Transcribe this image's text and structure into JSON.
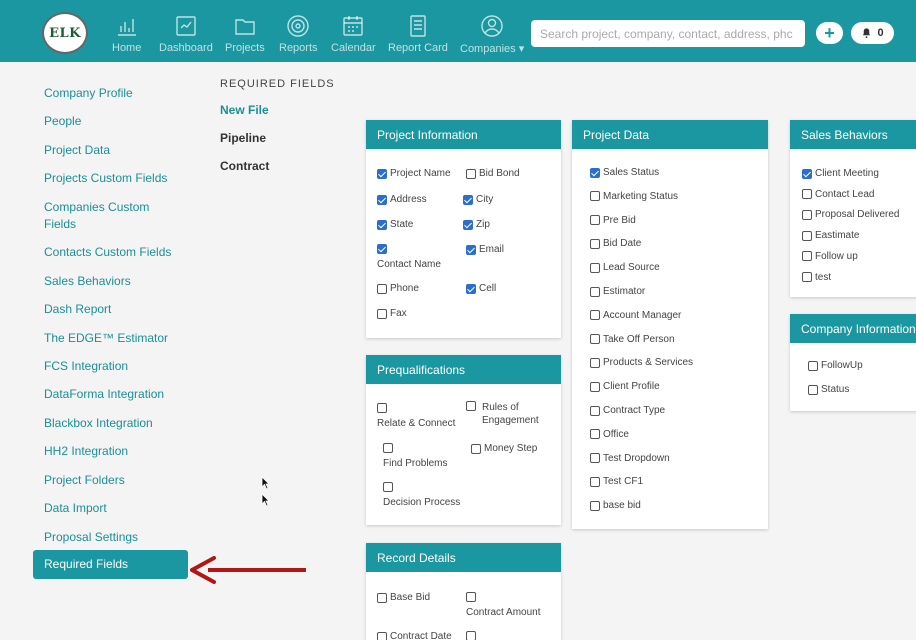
{
  "header": {
    "logo_text": "ELK",
    "nav": [
      {
        "label": "Home",
        "icon": "bar-chart-icon"
      },
      {
        "label": "Dashboard",
        "icon": "dashboard-icon"
      },
      {
        "label": "Projects",
        "icon": "folder-icon"
      },
      {
        "label": "Reports",
        "icon": "target-icon"
      },
      {
        "label": "Calendar",
        "icon": "calendar-icon"
      },
      {
        "label": "Report Card",
        "icon": "report-card-icon"
      },
      {
        "label": "Companies ▾",
        "icon": "user-icon"
      }
    ],
    "search_placeholder": "Search project, company, contact, address, phc",
    "add_label": "+",
    "notification_count": "0"
  },
  "sidebar": {
    "items": [
      "Company Profile",
      "People",
      "Project Data",
      "Projects Custom Fields",
      "Companies Custom Fields",
      "Contacts Custom Fields",
      "Sales Behaviors",
      "Dash Report",
      "The EDGE™ Estimator",
      "FCS Integration",
      "DataForma Integration",
      "Blackbox Integration",
      "HH2 Integration",
      "Project Folders",
      "Data Import",
      "Proposal Settings"
    ],
    "active": "Required Fields"
  },
  "required_fields": {
    "heading": "REQUIRED FIELDS",
    "items": [
      "New File",
      "Pipeline",
      "Contract"
    ]
  },
  "cards": {
    "project_information": {
      "title": "Project Information",
      "options": [
        {
          "label": "Project Name",
          "checked": true
        },
        {
          "label": "Bid Bond",
          "checked": false
        },
        {
          "label": "Address",
          "checked": true
        },
        {
          "label": "City",
          "checked": true
        },
        {
          "label": "State",
          "checked": true
        },
        {
          "label": "Zip",
          "checked": true
        },
        {
          "label": "Contact Name",
          "checked": true
        },
        {
          "label": "Email",
          "checked": true
        },
        {
          "label": "Phone",
          "checked": false
        },
        {
          "label": "Cell",
          "checked": true
        },
        {
          "label": "Fax",
          "checked": false
        }
      ]
    },
    "prequalifications": {
      "title": "Prequalifications",
      "options": [
        {
          "label": "Relate & Connect",
          "checked": false
        },
        {
          "label": "Rules of Engagement",
          "checked": false
        },
        {
          "label": "Find Problems",
          "checked": false
        },
        {
          "label": "Money Step",
          "checked": false
        },
        {
          "label": "Decision Process",
          "checked": false
        }
      ]
    },
    "record_details": {
      "title": "Record Details",
      "options": [
        {
          "label": "Base Bid",
          "checked": false
        },
        {
          "label": "Contract Amount",
          "checked": false
        },
        {
          "label": "Contract Date",
          "checked": false
        }
      ]
    },
    "project_data": {
      "title": "Project Data",
      "options": [
        {
          "label": "Sales Status",
          "checked": true
        },
        {
          "label": "Marketing Status",
          "checked": false
        },
        {
          "label": "Pre Bid",
          "checked": false
        },
        {
          "label": "Bid Date",
          "checked": false
        },
        {
          "label": "Lead Source",
          "checked": false
        },
        {
          "label": "Estimator",
          "checked": false
        },
        {
          "label": "Account Manager",
          "checked": false
        },
        {
          "label": "Take Off Person",
          "checked": false
        },
        {
          "label": "Products & Services",
          "checked": false
        },
        {
          "label": "Client Profile",
          "checked": false
        },
        {
          "label": "Contract Type",
          "checked": false
        },
        {
          "label": "Office",
          "checked": false
        },
        {
          "label": "Test Dropdown",
          "checked": false
        },
        {
          "label": "Test CF1",
          "checked": false
        },
        {
          "label": "base bid",
          "checked": false
        }
      ]
    },
    "sales_behaviors": {
      "title": "Sales Behaviors",
      "options": [
        {
          "label": "Client Meeting",
          "checked": true
        },
        {
          "label": "Contact Lead",
          "checked": false
        },
        {
          "label": "Proposal Delivered",
          "checked": false
        },
        {
          "label": "Eastimate",
          "checked": false
        },
        {
          "label": "Follow up",
          "checked": false
        },
        {
          "label": "test",
          "checked": false
        }
      ]
    },
    "company_information": {
      "title": "Company Information",
      "options": [
        {
          "label": "FollowUp",
          "checked": false
        },
        {
          "label": "Status",
          "checked": false
        }
      ]
    }
  },
  "colors": {
    "accent": "#1a97a0",
    "checkbox": "#2b6fce",
    "arrow": "#b01818"
  }
}
